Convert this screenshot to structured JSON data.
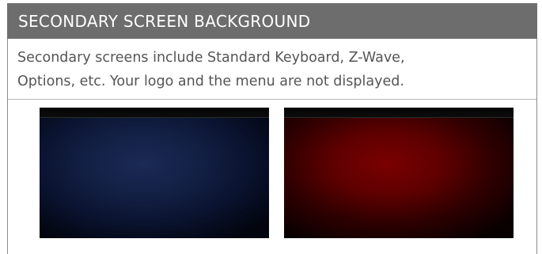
{
  "header": {
    "title": "SECONDARY SCREEN BACKGROUND"
  },
  "description": {
    "line1": "Secondary screens include Standard Keyboard, Z-Wave,",
    "line2": "Options, etc. Your logo and the menu are not displayed."
  },
  "colors": {
    "header_background": "#6d6d6d",
    "header_text": "#ffffff",
    "body_text": "#555555",
    "option_blue": "#132045",
    "option_red": "#7a0000"
  },
  "background_options": [
    {
      "id": "blue",
      "icon": "blue-background-preview"
    },
    {
      "id": "red",
      "icon": "red-background-preview"
    }
  ]
}
